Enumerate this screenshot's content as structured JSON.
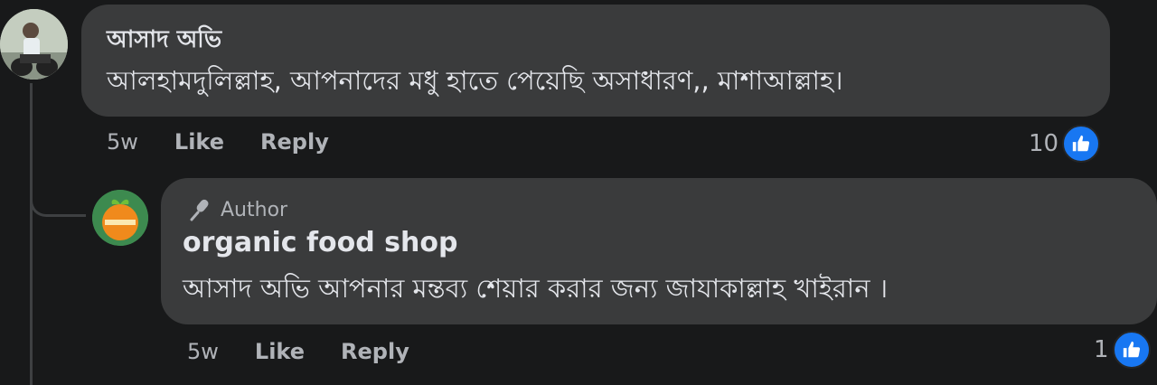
{
  "comments": [
    {
      "author_name": "আসাদ অভি",
      "text": "আলহামদুলিল্লাহ, আপনাদের মধু হাতে পেয়েছি অসাধারণ,, মাশাআল্লাহ।",
      "time": "5w",
      "like_label": "Like",
      "reply_label": "Reply",
      "reaction_count": "10",
      "reaction_icon": "like-icon"
    }
  ],
  "reply": {
    "badge_label": "Author",
    "badge_icon": "microphone-icon",
    "author_name": "organic food shop",
    "text": "আসাদ অভি আপনার মন্তব্য শেয়ার করার জন্য জাযাকাল্লাহ খাইরান ।",
    "time": "5w",
    "like_label": "Like",
    "reply_label": "Reply",
    "reaction_count": "1",
    "reaction_icon": "like-icon"
  },
  "colors": {
    "background": "#18191a",
    "bubble": "#3a3b3c",
    "like_blue": "#1877f2",
    "secondary_text": "#b0b3b8"
  }
}
